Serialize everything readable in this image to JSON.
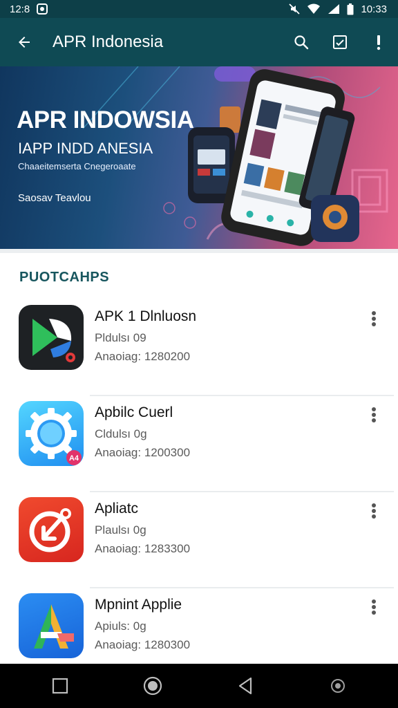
{
  "status_bar": {
    "left_time": "12:8",
    "right_time": "10:33",
    "icons": [
      "notification-icon",
      "mute-icon",
      "wifi-icon",
      "signal-icon",
      "battery-icon"
    ]
  },
  "app_bar": {
    "title": "APR Indonesia",
    "icons": [
      "back-arrow-icon",
      "search-icon",
      "checkbox-icon",
      "overflow-icon"
    ]
  },
  "hero": {
    "title": "APR INDOWSIA",
    "subtitle": "IAPP INDD ANESIA",
    "tagline": "Chaaeitemserta Cnegeroaate",
    "note": "Saosav Teavlou"
  },
  "section": {
    "title": "PUOTCAHPS"
  },
  "apps": [
    {
      "name": "APK 1 Dlnluosn",
      "line1": "Pldulsı 09",
      "line2": "Anaoiag: 1280200",
      "icon": "play-app-icon"
    },
    {
      "name": "Apbilc Cuerl",
      "line1": "Cldulsı 0g",
      "line2": "Anaoiag: 1200300",
      "icon": "gear-app-icon",
      "badge": "A4"
    },
    {
      "name": "Apliatc",
      "line1": "Plaulsı 0g",
      "line2": "Anaoiag: 1283300",
      "icon": "target-app-icon"
    },
    {
      "name": "Mpnint Applie",
      "line1": "Apiuls: 0g",
      "line2": "Anaoiag: 1280300",
      "icon": "a-letter-app-icon"
    }
  ],
  "nav_bar": {
    "icons": [
      "recents-square-icon",
      "home-circle-icon",
      "back-triangle-icon",
      "assistant-icon"
    ]
  },
  "colors": {
    "status_bar": "#0d3f48",
    "app_bar": "#0f4a54",
    "section_title": "#17565e",
    "nav_bar": "#000000"
  }
}
